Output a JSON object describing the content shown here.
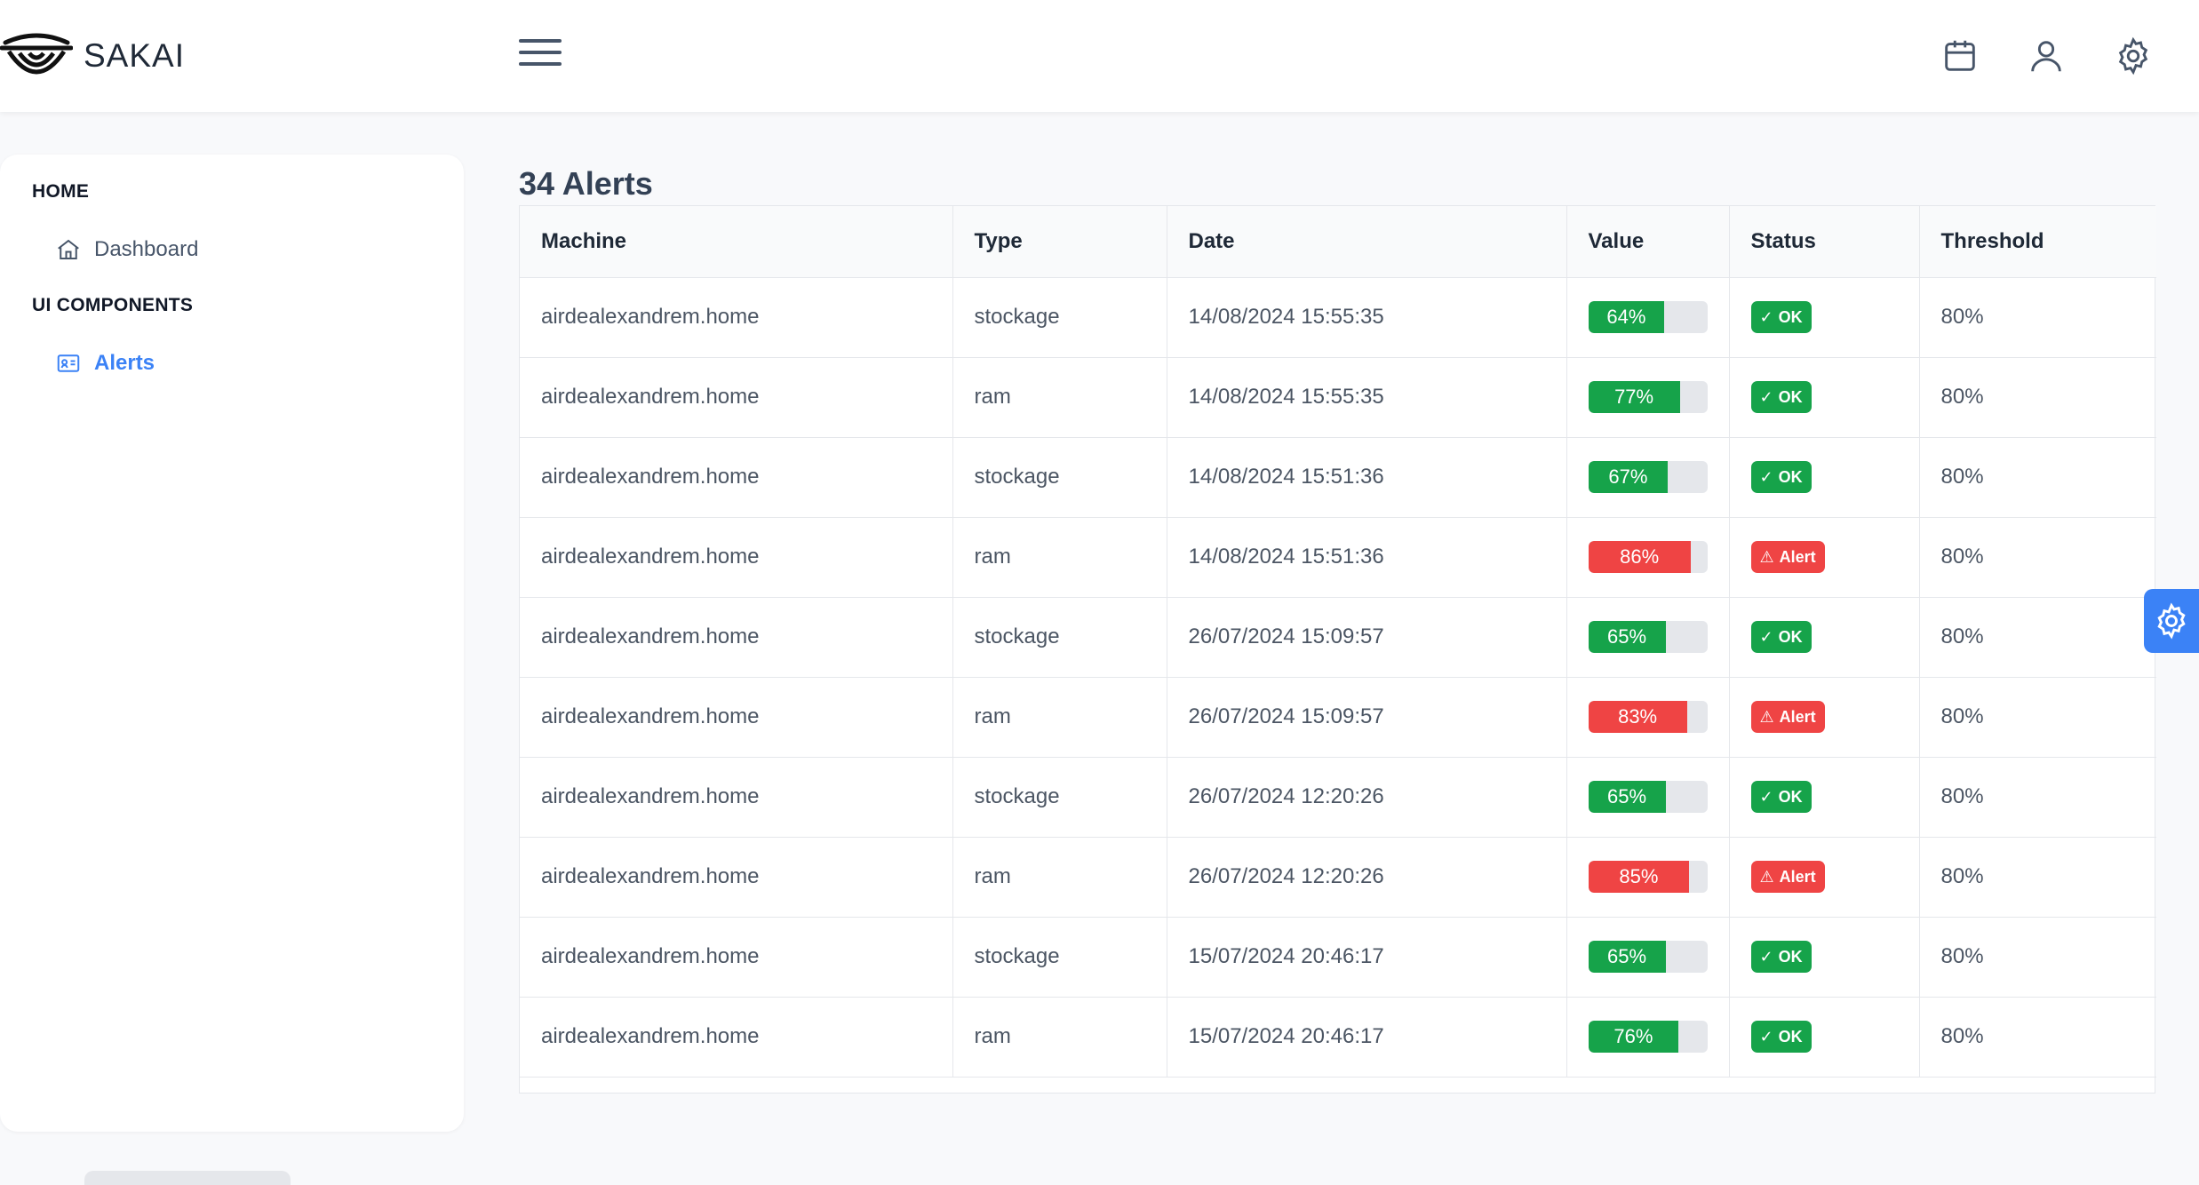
{
  "app": {
    "name": "SAKAI"
  },
  "sidebar": {
    "sections": [
      {
        "title": "HOME",
        "items": [
          {
            "label": "Dashboard",
            "icon": "home-icon",
            "active": false
          }
        ]
      },
      {
        "title": "UI COMPONENTS",
        "items": [
          {
            "label": "Alerts",
            "icon": "id-card-icon",
            "active": true
          }
        ]
      }
    ]
  },
  "main": {
    "title": "34 Alerts",
    "columns": [
      "Machine",
      "Type",
      "Date",
      "Value",
      "Status",
      "Threshold"
    ],
    "rows": [
      {
        "machine": "airdealexandrem.home",
        "type": "stockage",
        "date": "14/08/2024 15:55:35",
        "value": "64%",
        "value_num": 64,
        "status": "OK",
        "threshold": "80%"
      },
      {
        "machine": "airdealexandrem.home",
        "type": "ram",
        "date": "14/08/2024 15:55:35",
        "value": "77%",
        "value_num": 77,
        "status": "OK",
        "threshold": "80%"
      },
      {
        "machine": "airdealexandrem.home",
        "type": "stockage",
        "date": "14/08/2024 15:51:36",
        "value": "67%",
        "value_num": 67,
        "status": "OK",
        "threshold": "80%"
      },
      {
        "machine": "airdealexandrem.home",
        "type": "ram",
        "date": "14/08/2024 15:51:36",
        "value": "86%",
        "value_num": 86,
        "status": "Alert",
        "threshold": "80%"
      },
      {
        "machine": "airdealexandrem.home",
        "type": "stockage",
        "date": "26/07/2024 15:09:57",
        "value": "65%",
        "value_num": 65,
        "status": "OK",
        "threshold": "80%"
      },
      {
        "machine": "airdealexandrem.home",
        "type": "ram",
        "date": "26/07/2024 15:09:57",
        "value": "83%",
        "value_num": 83,
        "status": "Alert",
        "threshold": "80%"
      },
      {
        "machine": "airdealexandrem.home",
        "type": "stockage",
        "date": "26/07/2024 12:20:26",
        "value": "65%",
        "value_num": 65,
        "status": "OK",
        "threshold": "80%"
      },
      {
        "machine": "airdealexandrem.home",
        "type": "ram",
        "date": "26/07/2024 12:20:26",
        "value": "85%",
        "value_num": 85,
        "status": "Alert",
        "threshold": "80%"
      },
      {
        "machine": "airdealexandrem.home",
        "type": "stockage",
        "date": "15/07/2024 20:46:17",
        "value": "65%",
        "value_num": 65,
        "status": "OK",
        "threshold": "80%"
      },
      {
        "machine": "airdealexandrem.home",
        "type": "ram",
        "date": "15/07/2024 20:46:17",
        "value": "76%",
        "value_num": 76,
        "status": "OK",
        "threshold": "80%"
      }
    ]
  },
  "colors": {
    "accent": "#3b82f6",
    "ok": "#16a34a",
    "alert": "#ef4444"
  },
  "icons": [
    "menu-icon",
    "calendar-icon",
    "user-icon",
    "settings-icon",
    "home-icon",
    "id-card-icon",
    "check-icon",
    "warning-icon",
    "config-gear-icon"
  ]
}
